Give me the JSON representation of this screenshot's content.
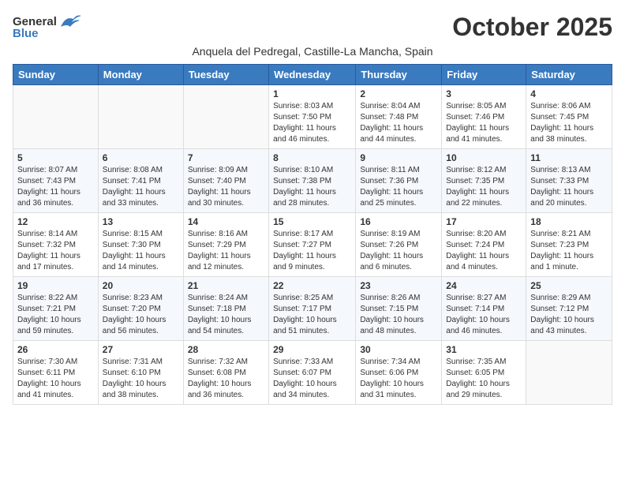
{
  "header": {
    "logo_general": "General",
    "logo_blue": "Blue",
    "month_title": "October 2025",
    "location": "Anquela del Pedregal, Castille-La Mancha, Spain"
  },
  "days_of_week": [
    "Sunday",
    "Monday",
    "Tuesday",
    "Wednesday",
    "Thursday",
    "Friday",
    "Saturday"
  ],
  "weeks": [
    [
      {
        "day": "",
        "sunrise": "",
        "sunset": "",
        "daylight": ""
      },
      {
        "day": "",
        "sunrise": "",
        "sunset": "",
        "daylight": ""
      },
      {
        "day": "",
        "sunrise": "",
        "sunset": "",
        "daylight": ""
      },
      {
        "day": "1",
        "sunrise": "Sunrise: 8:03 AM",
        "sunset": "Sunset: 7:50 PM",
        "daylight": "Daylight: 11 hours and 46 minutes."
      },
      {
        "day": "2",
        "sunrise": "Sunrise: 8:04 AM",
        "sunset": "Sunset: 7:48 PM",
        "daylight": "Daylight: 11 hours and 44 minutes."
      },
      {
        "day": "3",
        "sunrise": "Sunrise: 8:05 AM",
        "sunset": "Sunset: 7:46 PM",
        "daylight": "Daylight: 11 hours and 41 minutes."
      },
      {
        "day": "4",
        "sunrise": "Sunrise: 8:06 AM",
        "sunset": "Sunset: 7:45 PM",
        "daylight": "Daylight: 11 hours and 38 minutes."
      }
    ],
    [
      {
        "day": "5",
        "sunrise": "Sunrise: 8:07 AM",
        "sunset": "Sunset: 7:43 PM",
        "daylight": "Daylight: 11 hours and 36 minutes."
      },
      {
        "day": "6",
        "sunrise": "Sunrise: 8:08 AM",
        "sunset": "Sunset: 7:41 PM",
        "daylight": "Daylight: 11 hours and 33 minutes."
      },
      {
        "day": "7",
        "sunrise": "Sunrise: 8:09 AM",
        "sunset": "Sunset: 7:40 PM",
        "daylight": "Daylight: 11 hours and 30 minutes."
      },
      {
        "day": "8",
        "sunrise": "Sunrise: 8:10 AM",
        "sunset": "Sunset: 7:38 PM",
        "daylight": "Daylight: 11 hours and 28 minutes."
      },
      {
        "day": "9",
        "sunrise": "Sunrise: 8:11 AM",
        "sunset": "Sunset: 7:36 PM",
        "daylight": "Daylight: 11 hours and 25 minutes."
      },
      {
        "day": "10",
        "sunrise": "Sunrise: 8:12 AM",
        "sunset": "Sunset: 7:35 PM",
        "daylight": "Daylight: 11 hours and 22 minutes."
      },
      {
        "day": "11",
        "sunrise": "Sunrise: 8:13 AM",
        "sunset": "Sunset: 7:33 PM",
        "daylight": "Daylight: 11 hours and 20 minutes."
      }
    ],
    [
      {
        "day": "12",
        "sunrise": "Sunrise: 8:14 AM",
        "sunset": "Sunset: 7:32 PM",
        "daylight": "Daylight: 11 hours and 17 minutes."
      },
      {
        "day": "13",
        "sunrise": "Sunrise: 8:15 AM",
        "sunset": "Sunset: 7:30 PM",
        "daylight": "Daylight: 11 hours and 14 minutes."
      },
      {
        "day": "14",
        "sunrise": "Sunrise: 8:16 AM",
        "sunset": "Sunset: 7:29 PM",
        "daylight": "Daylight: 11 hours and 12 minutes."
      },
      {
        "day": "15",
        "sunrise": "Sunrise: 8:17 AM",
        "sunset": "Sunset: 7:27 PM",
        "daylight": "Daylight: 11 hours and 9 minutes."
      },
      {
        "day": "16",
        "sunrise": "Sunrise: 8:19 AM",
        "sunset": "Sunset: 7:26 PM",
        "daylight": "Daylight: 11 hours and 6 minutes."
      },
      {
        "day": "17",
        "sunrise": "Sunrise: 8:20 AM",
        "sunset": "Sunset: 7:24 PM",
        "daylight": "Daylight: 11 hours and 4 minutes."
      },
      {
        "day": "18",
        "sunrise": "Sunrise: 8:21 AM",
        "sunset": "Sunset: 7:23 PM",
        "daylight": "Daylight: 11 hours and 1 minute."
      }
    ],
    [
      {
        "day": "19",
        "sunrise": "Sunrise: 8:22 AM",
        "sunset": "Sunset: 7:21 PM",
        "daylight": "Daylight: 10 hours and 59 minutes."
      },
      {
        "day": "20",
        "sunrise": "Sunrise: 8:23 AM",
        "sunset": "Sunset: 7:20 PM",
        "daylight": "Daylight: 10 hours and 56 minutes."
      },
      {
        "day": "21",
        "sunrise": "Sunrise: 8:24 AM",
        "sunset": "Sunset: 7:18 PM",
        "daylight": "Daylight: 10 hours and 54 minutes."
      },
      {
        "day": "22",
        "sunrise": "Sunrise: 8:25 AM",
        "sunset": "Sunset: 7:17 PM",
        "daylight": "Daylight: 10 hours and 51 minutes."
      },
      {
        "day": "23",
        "sunrise": "Sunrise: 8:26 AM",
        "sunset": "Sunset: 7:15 PM",
        "daylight": "Daylight: 10 hours and 48 minutes."
      },
      {
        "day": "24",
        "sunrise": "Sunrise: 8:27 AM",
        "sunset": "Sunset: 7:14 PM",
        "daylight": "Daylight: 10 hours and 46 minutes."
      },
      {
        "day": "25",
        "sunrise": "Sunrise: 8:29 AM",
        "sunset": "Sunset: 7:12 PM",
        "daylight": "Daylight: 10 hours and 43 minutes."
      }
    ],
    [
      {
        "day": "26",
        "sunrise": "Sunrise: 7:30 AM",
        "sunset": "Sunset: 6:11 PM",
        "daylight": "Daylight: 10 hours and 41 minutes."
      },
      {
        "day": "27",
        "sunrise": "Sunrise: 7:31 AM",
        "sunset": "Sunset: 6:10 PM",
        "daylight": "Daylight: 10 hours and 38 minutes."
      },
      {
        "day": "28",
        "sunrise": "Sunrise: 7:32 AM",
        "sunset": "Sunset: 6:08 PM",
        "daylight": "Daylight: 10 hours and 36 minutes."
      },
      {
        "day": "29",
        "sunrise": "Sunrise: 7:33 AM",
        "sunset": "Sunset: 6:07 PM",
        "daylight": "Daylight: 10 hours and 34 minutes."
      },
      {
        "day": "30",
        "sunrise": "Sunrise: 7:34 AM",
        "sunset": "Sunset: 6:06 PM",
        "daylight": "Daylight: 10 hours and 31 minutes."
      },
      {
        "day": "31",
        "sunrise": "Sunrise: 7:35 AM",
        "sunset": "Sunset: 6:05 PM",
        "daylight": "Daylight: 10 hours and 29 minutes."
      },
      {
        "day": "",
        "sunrise": "",
        "sunset": "",
        "daylight": ""
      }
    ]
  ]
}
